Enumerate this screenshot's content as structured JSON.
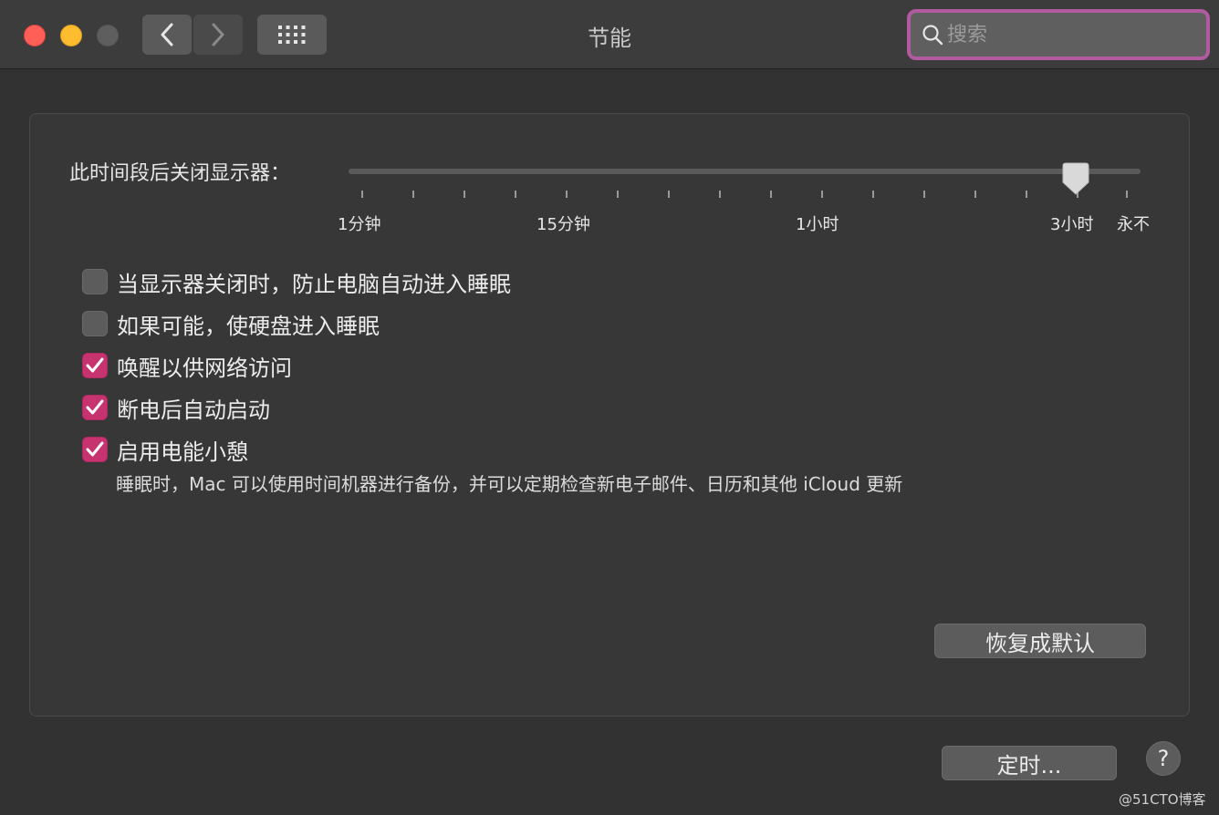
{
  "window": {
    "title": "节能"
  },
  "toolbar": {
    "back_icon": "chevron-left-icon",
    "forward_icon": "chevron-right-icon",
    "grid_icon": "grid-icon"
  },
  "search": {
    "placeholder": "搜索",
    "value": ""
  },
  "display_sleep": {
    "label": "此时间段后关闭显示器：",
    "ticks": [
      "1分钟",
      "15分钟",
      "1小时",
      "3小时",
      "永不"
    ],
    "selected": "3小时"
  },
  "options": [
    {
      "label": "当显示器关闭时，防止电脑自动进入睡眠",
      "checked": false
    },
    {
      "label": "如果可能，使硬盘进入睡眠",
      "checked": false
    },
    {
      "label": "唤醒以供网络访问",
      "checked": true
    },
    {
      "label": "断电后自动启动",
      "checked": true
    },
    {
      "label": "启用电能小憩",
      "checked": true
    }
  ],
  "power_nap_description": "睡眠时，Mac 可以使用时间机器进行备份，并可以定期检查新电子邮件、日历和其他 iCloud 更新",
  "buttons": {
    "restore_defaults": "恢复成默认",
    "schedule": "定时...",
    "help": "?"
  },
  "watermark": "@51CTO博客",
  "colors": {
    "accent": "#c7336f",
    "search_focus": "#b25aa0",
    "close": "#ff5f57",
    "minimize": "#febc2e"
  }
}
